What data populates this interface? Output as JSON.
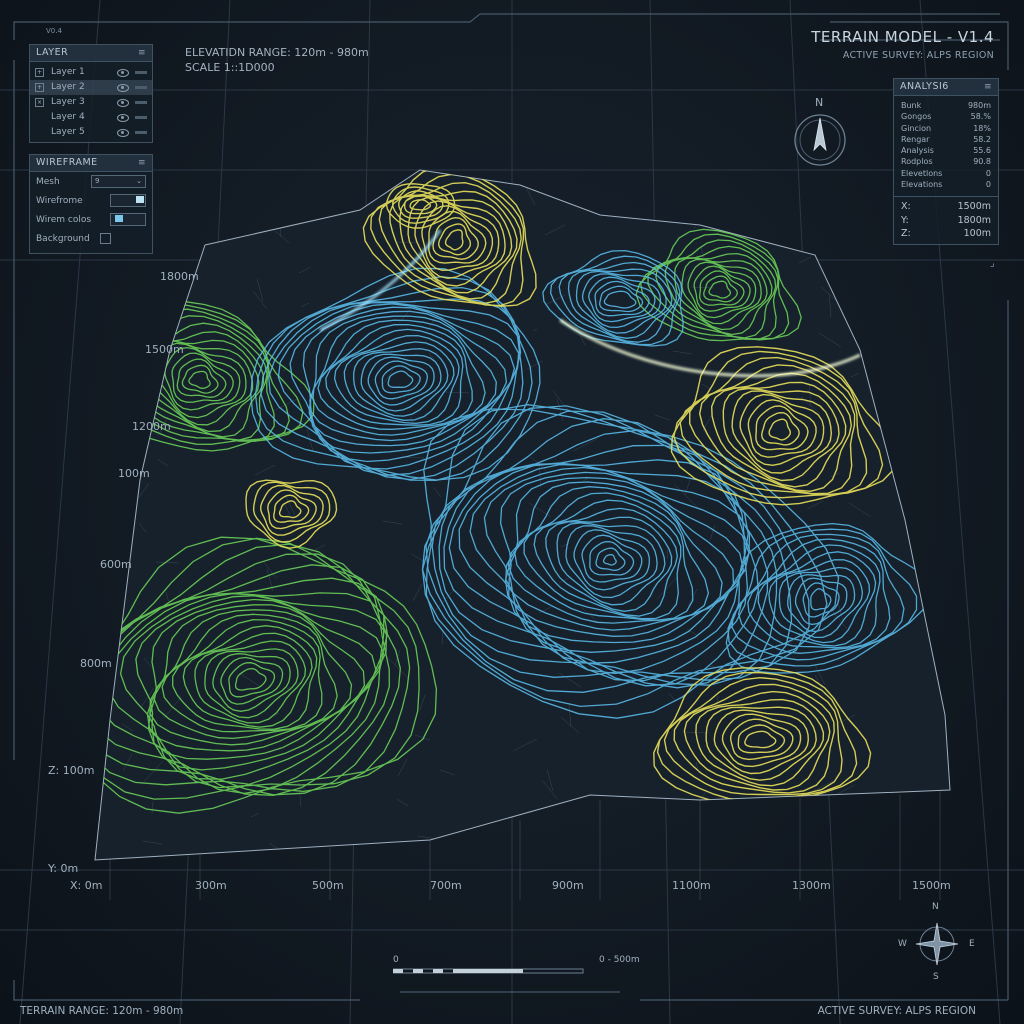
{
  "app": {
    "title": "TERRAIN MODEL - V1.4",
    "subtitle": "ACTIVE SURVEY: ALPS REGION",
    "corner_tag": "V0.4"
  },
  "info": {
    "elevation_range": "ELEVATIDN RANGE: 120m - 980m",
    "scale": "SCALE 1::1D000"
  },
  "layer_panel": {
    "title": "LAYER",
    "items": [
      {
        "label": "Layer 1",
        "check": "+"
      },
      {
        "label": "Layer 2",
        "check": "+"
      },
      {
        "label": "Layer 3",
        "check": "×"
      },
      {
        "label": "Layer 4",
        "check": ""
      },
      {
        "label": "Layer 5",
        "check": ""
      }
    ]
  },
  "wireframe_panel": {
    "title": "WIREFRAME",
    "mesh_label": "Mesh",
    "mesh_value": "9",
    "wireframe_label": "Wirefrome",
    "color_label": "Wirem colos",
    "background_label": "Background"
  },
  "analysis_panel": {
    "title": "ANALYSI6",
    "rows": [
      {
        "label": "Bunk",
        "value": "980m"
      },
      {
        "label": "Gongos",
        "value": "58.%"
      },
      {
        "label": "Gincion",
        "value": "18%"
      },
      {
        "label": "Rengar",
        "value": "58.2"
      },
      {
        "label": "Analysis",
        "value": "55.6"
      },
      {
        "label": "Rodplos",
        "value": "90.8"
      },
      {
        "label": "Elevetlons",
        "value": "0"
      },
      {
        "label": "Elevations",
        "value": "0"
      }
    ],
    "coords": [
      {
        "label": "X:",
        "value": "1500m"
      },
      {
        "label": "Y:",
        "value": "1800m"
      },
      {
        "label": "Z:",
        "value": "100m"
      }
    ]
  },
  "y_axis": [
    "1800m",
    "1500m",
    "1200m",
    "100m",
    "600m",
    "800m",
    "Z: 100m",
    "Y: 0m"
  ],
  "x_axis": [
    "X: 0m",
    "300m",
    "500m",
    "700m",
    "900m",
    "1100m",
    "1300m",
    "1500m"
  ],
  "compass_top": {
    "n": "N"
  },
  "compass_bottom": {
    "n": "N",
    "s": "S",
    "e": "E",
    "w": "W"
  },
  "scale_bar": {
    "start": "0",
    "end": "0 - 500m"
  },
  "footer": {
    "left": "TERRAIN RANGE: 120m - 980m",
    "right": "ACTIVE SURVEY: ALPS REGION"
  },
  "colors": {
    "yellow": "#e8e05a",
    "blue": "#5cc0f0",
    "green": "#6fd85a"
  }
}
